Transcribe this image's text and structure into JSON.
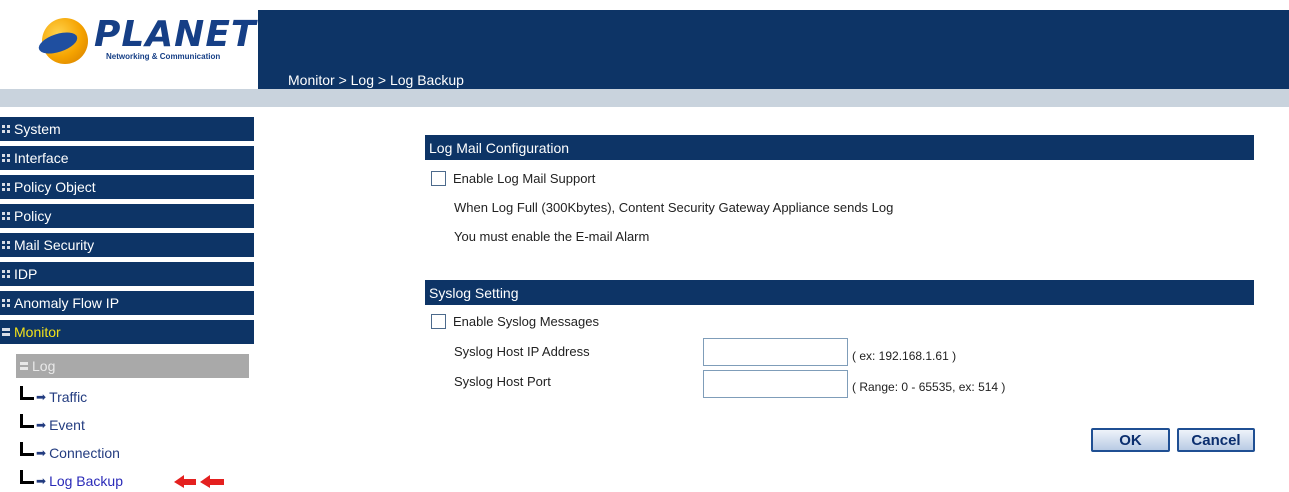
{
  "brand": {
    "name": "PLANET",
    "tagline": "Networking & Communication"
  },
  "breadcrumb": "Monitor > Log > Log Backup",
  "sidebar": {
    "items": [
      {
        "label": "System",
        "expanded": false
      },
      {
        "label": "Interface",
        "expanded": false
      },
      {
        "label": "Policy Object",
        "expanded": false
      },
      {
        "label": "Policy",
        "expanded": false
      },
      {
        "label": "Mail Security",
        "expanded": false
      },
      {
        "label": "IDP",
        "expanded": false
      },
      {
        "label": "Anomaly Flow IP",
        "expanded": false
      },
      {
        "label": "Monitor",
        "expanded": true
      }
    ],
    "log": {
      "label": "Log"
    },
    "sub_items": [
      {
        "label": "Traffic"
      },
      {
        "label": "Event"
      },
      {
        "label": "Connection"
      },
      {
        "label": "Log Backup"
      }
    ]
  },
  "log_mail": {
    "title": "Log Mail Configuration",
    "enable_label": "Enable Log Mail Support",
    "enabled": false,
    "note1": "When Log Full (300Kbytes), Content Security Gateway Appliance sends Log",
    "note2": "You must enable the E-mail Alarm"
  },
  "syslog": {
    "title": "Syslog Setting",
    "enable_label": "Enable Syslog Messages",
    "enabled": false,
    "host_ip_label": "Syslog Host IP Address",
    "host_ip_value": "",
    "host_ip_hint": "( ex: 192.168.1.61 )",
    "host_port_label": "Syslog Host Port",
    "host_port_value": "",
    "host_port_hint": "( Range: 0 - 65535, ex: 514 )"
  },
  "buttons": {
    "ok": "OK",
    "cancel": "Cancel"
  },
  "colors": {
    "nav_bg": "#0d3466",
    "active_nav_text": "#f2e21a",
    "stripe": "#c9d3dd",
    "log_bg": "#a9a9a9"
  }
}
